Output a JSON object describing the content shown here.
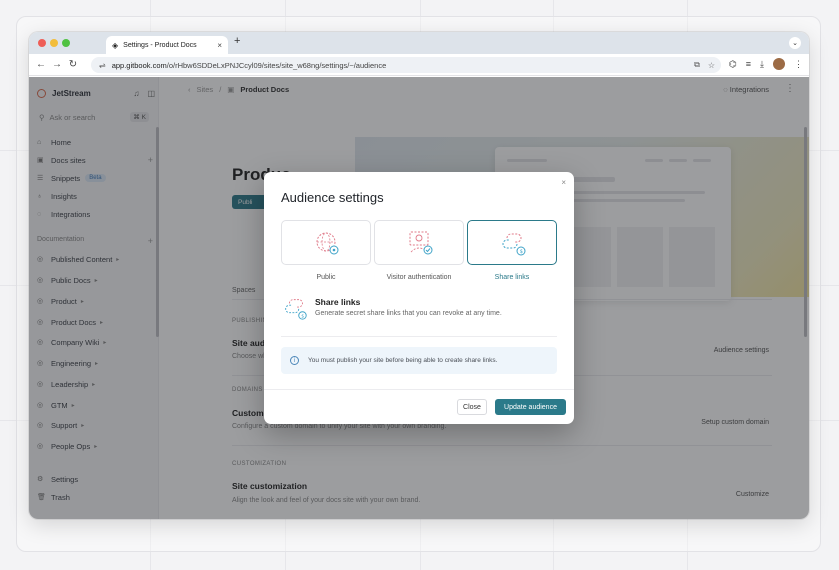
{
  "browser": {
    "tab_title": "Settings - Product Docs",
    "tab_close": "×",
    "new_tab": "+",
    "url_host": "app.gitbook.com",
    "url_path": "/o/rHbw6SDDeLxPNJCcyl09/sites/site_w68ng/settings/~/audience"
  },
  "sidebar": {
    "org_name": "JetStream",
    "search_placeholder": "Ask or search",
    "search_shortcut": "⌘ K",
    "items": [
      {
        "label": "Home"
      },
      {
        "label": "Docs sites"
      },
      {
        "label": "Snippets",
        "badge": "Beta"
      },
      {
        "label": "Insights"
      },
      {
        "label": "Integrations"
      }
    ],
    "documentation_label": "Documentation",
    "spaces": [
      {
        "label": "Published Content"
      },
      {
        "label": "Public Docs"
      },
      {
        "label": "Product"
      },
      {
        "label": "Product Docs"
      },
      {
        "label": "Company Wiki"
      },
      {
        "label": "Engineering"
      },
      {
        "label": "Leadership"
      },
      {
        "label": "GTM"
      },
      {
        "label": "Support"
      },
      {
        "label": "People Ops"
      }
    ],
    "bottom_items": [
      {
        "label": "Settings"
      },
      {
        "label": "Trash"
      }
    ]
  },
  "main": {
    "breadcrumb_root": "Sites",
    "breadcrumb_current": "Product Docs",
    "integrations_label": "Integrations",
    "page_title": "Produc",
    "publish_label": "Publi",
    "spaces_label": "Spaces",
    "publishing_label": "PUBLISHIN",
    "site_audience_title": "Site audi",
    "site_audience_desc": "Choose wh",
    "audience_settings_btn": "Audience settings",
    "domain_label": "DOMAINS",
    "custom_domain_title": "Custom d",
    "custom_domain_desc": "Configure a custom domain to unify your site with your own branding.",
    "setup_domain_btn": "Setup custom domain",
    "customization_label": "CUSTOMIZATION",
    "customization_title": "Site customization",
    "customization_desc": "Align the look and feel of your docs site with your own brand.",
    "customize_btn": "Customize"
  },
  "modal": {
    "title": "Audience settings",
    "close_glyph": "×",
    "options": [
      {
        "label": "Public",
        "selected": false
      },
      {
        "label": "Visitor authentication",
        "selected": false
      },
      {
        "label": "Share links",
        "selected": true
      }
    ],
    "selected_title": "Share links",
    "selected_desc": "Generate secret share links that you can revoke at any time.",
    "notice": "You must publish your site before being able to create share links.",
    "close_label": "Close",
    "update_label": "Update audience"
  },
  "colors": {
    "accent": "#2b7a8a",
    "overlay": "#1e2024"
  }
}
